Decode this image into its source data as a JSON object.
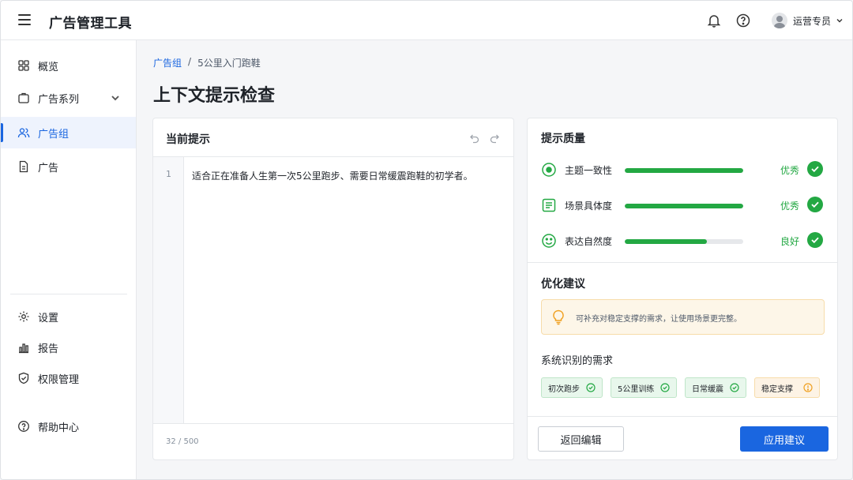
{
  "app": {
    "title": "广告管理工具"
  },
  "user": {
    "name": "运营专员"
  },
  "sidebar": {
    "items": [
      {
        "label": "概览",
        "icon": "grid-icon"
      },
      {
        "label": "广告系列",
        "icon": "briefcase-icon"
      },
      {
        "label": "广告组",
        "icon": "users-icon",
        "active": true
      },
      {
        "label": "广告",
        "icon": "document-icon"
      }
    ],
    "bottom_items": [
      {
        "label": "设置",
        "icon": "gear-icon"
      },
      {
        "label": "报告",
        "icon": "bar-chart-icon"
      },
      {
        "label": "权限管理",
        "icon": "shield-icon"
      },
      {
        "label": "帮助中心",
        "icon": "help-icon"
      }
    ]
  },
  "breadcrumb": {
    "parent": "广告组",
    "separator": "/",
    "current": "5公里入门跑鞋"
  },
  "page": {
    "title": "上下文提示检查"
  },
  "editor": {
    "title": "当前提示",
    "line_number": "1",
    "text": "适合正在准备人生第一次5公里跑步、需要日常缓震跑鞋的初学者。",
    "char_count": "32 / 500"
  },
  "quality": {
    "title": "提示质量",
    "metrics": [
      {
        "label": "主题一致性",
        "status": "优秀",
        "level": 1.0,
        "icon": "target-icon"
      },
      {
        "label": "场景具体度",
        "status": "优秀",
        "level": 1.0,
        "icon": "list-doc-icon"
      },
      {
        "label": "表达自然度",
        "status": "良好",
        "level": 0.69,
        "icon": "smile-icon"
      }
    ]
  },
  "suggestions": {
    "title": "优化建议",
    "tip": "可补充对稳定支撑的需求，让使用场景更完整。"
  },
  "needs": {
    "title": "系统识别的需求",
    "tags": [
      {
        "label": "初次跑步",
        "state": "ok"
      },
      {
        "label": "5公里训练",
        "state": "ok"
      },
      {
        "label": "日常缓震",
        "state": "ok"
      },
      {
        "label": "稳定支撑",
        "state": "warn"
      }
    ]
  },
  "actions": {
    "back_label": "返回编辑",
    "apply_label": "应用建议"
  },
  "colors": {
    "accent": "#1a66e0",
    "success": "#23a843",
    "warning": "#f0a020"
  }
}
